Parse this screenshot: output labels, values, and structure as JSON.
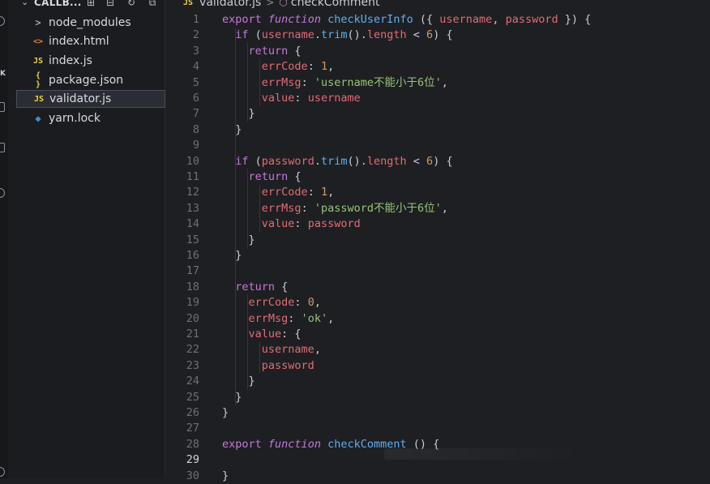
{
  "explorer": {
    "title": "CALLB...",
    "files": [
      {
        "name": "node_modules",
        "type": "folder",
        "icon": "chevron-right-icon"
      },
      {
        "name": "index.html",
        "type": "html",
        "icon": "html-file-icon"
      },
      {
        "name": "index.js",
        "type": "js",
        "icon": "js-file-icon"
      },
      {
        "name": "package.json",
        "type": "json",
        "icon": "json-file-icon"
      },
      {
        "name": "validator.js",
        "type": "js",
        "icon": "js-file-icon",
        "selected": true
      },
      {
        "name": "yarn.lock",
        "type": "yarn",
        "icon": "yarn-file-icon"
      }
    ],
    "icon_glyphs": {
      "folder": ">",
      "html": "<>",
      "js": "JS",
      "json": "{ }",
      "yarn": "◆"
    }
  },
  "activity_bar": {
    "letter": "K"
  },
  "breadcrumb": {
    "badge": "JS",
    "file": "validator.js",
    "separator": ">",
    "symbol": "checkComment"
  },
  "editor": {
    "active_line": 29,
    "lines": [
      {
        "n": "1",
        "text": "export function checkUserInfo ({ username, password }) {"
      },
      {
        "n": "2",
        "text": "  if (username.trim().length < 6) {"
      },
      {
        "n": "3",
        "text": "    return {"
      },
      {
        "n": "4",
        "text": "      errCode: 1,"
      },
      {
        "n": "5",
        "text": "      errMsg: 'username不能小于6位',"
      },
      {
        "n": "6",
        "text": "      value: username"
      },
      {
        "n": "7",
        "text": "    }"
      },
      {
        "n": "8",
        "text": "  }"
      },
      {
        "n": "9",
        "text": ""
      },
      {
        "n": "10",
        "text": "  if (password.trim().length < 6) {"
      },
      {
        "n": "11",
        "text": "    return {"
      },
      {
        "n": "12",
        "text": "      errCode: 1,"
      },
      {
        "n": "13",
        "text": "      errMsg: 'password不能小于6位',"
      },
      {
        "n": "14",
        "text": "      value: password"
      },
      {
        "n": "15",
        "text": "    }"
      },
      {
        "n": "16",
        "text": "  }"
      },
      {
        "n": "17",
        "text": ""
      },
      {
        "n": "18",
        "text": "  return {"
      },
      {
        "n": "19",
        "text": "    errCode: 0,"
      },
      {
        "n": "20",
        "text": "    errMsg: 'ok',"
      },
      {
        "n": "21",
        "text": "    value: {"
      },
      {
        "n": "22",
        "text": "      username,"
      },
      {
        "n": "23",
        "text": "      password"
      },
      {
        "n": "24",
        "text": "    }"
      },
      {
        "n": "25",
        "text": "  }"
      },
      {
        "n": "26",
        "text": "}"
      },
      {
        "n": "27",
        "text": ""
      },
      {
        "n": "28",
        "text": "export function checkComment () {"
      },
      {
        "n": "29",
        "text": ""
      },
      {
        "n": "30",
        "text": "}"
      }
    ]
  },
  "colors": {
    "keyword": "#c678dd",
    "function": "#61afef",
    "property": "#e06c75",
    "number": "#d19a66",
    "string": "#98c379",
    "bracket_gold": "#e5c07b"
  }
}
